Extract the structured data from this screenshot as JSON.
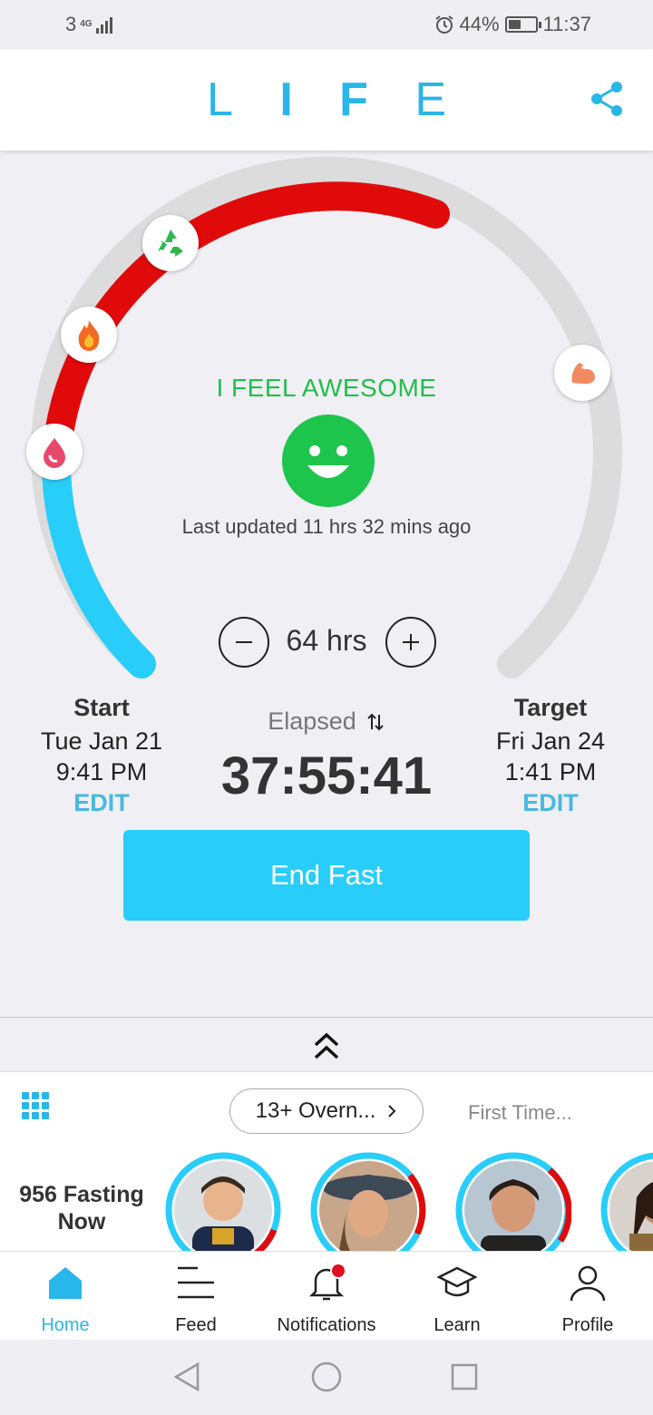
{
  "status": {
    "carrier": "3",
    "network": "4G",
    "battery": "44%",
    "time": "11:37"
  },
  "header": {
    "logo": [
      "L",
      "I",
      "F",
      "E"
    ]
  },
  "fast": {
    "feeling": "I FEEL AWESOME",
    "last_updated": "Last updated 11 hrs 32 mins ago",
    "goal_hours": "64 hrs",
    "progress_fraction": 0.59,
    "elapsed_label": "Elapsed",
    "elapsed_time": "37:55:41",
    "start": {
      "title": "Start",
      "date": "Tue Jan 21",
      "time": "9:41 PM",
      "edit": "EDIT"
    },
    "target": {
      "title": "Target",
      "date": "Fri Jan 24",
      "time": "1:41 PM",
      "edit": "EDIT"
    },
    "end_button": "End Fast",
    "milestones": [
      "blood-sugar-icon",
      "fat-burning-icon",
      "autophagy-icon",
      "muscle-icon"
    ]
  },
  "community": {
    "filter_active": "13+ Overn...",
    "filter_next": "First Time...",
    "count_text": "956 Fasting Now",
    "avatars": [
      "child-avatar",
      "hat-woman-avatar",
      "beach-woman-avatar",
      "leopard-woman-avatar"
    ]
  },
  "nav": [
    {
      "label": "Home",
      "icon": "home-icon",
      "active": true
    },
    {
      "label": "Feed",
      "icon": "feed-icon"
    },
    {
      "label": "Notifications",
      "icon": "bell-icon"
    },
    {
      "label": "Learn",
      "icon": "graduation-cap-icon"
    },
    {
      "label": "Profile",
      "icon": "person-icon"
    }
  ],
  "colors": {
    "accent": "#29b6e8",
    "arc_red": "#e10a0a",
    "arc_blue": "#29cdfa",
    "arc_gray": "#dcdcdc",
    "happy_green": "#1ec54c"
  }
}
